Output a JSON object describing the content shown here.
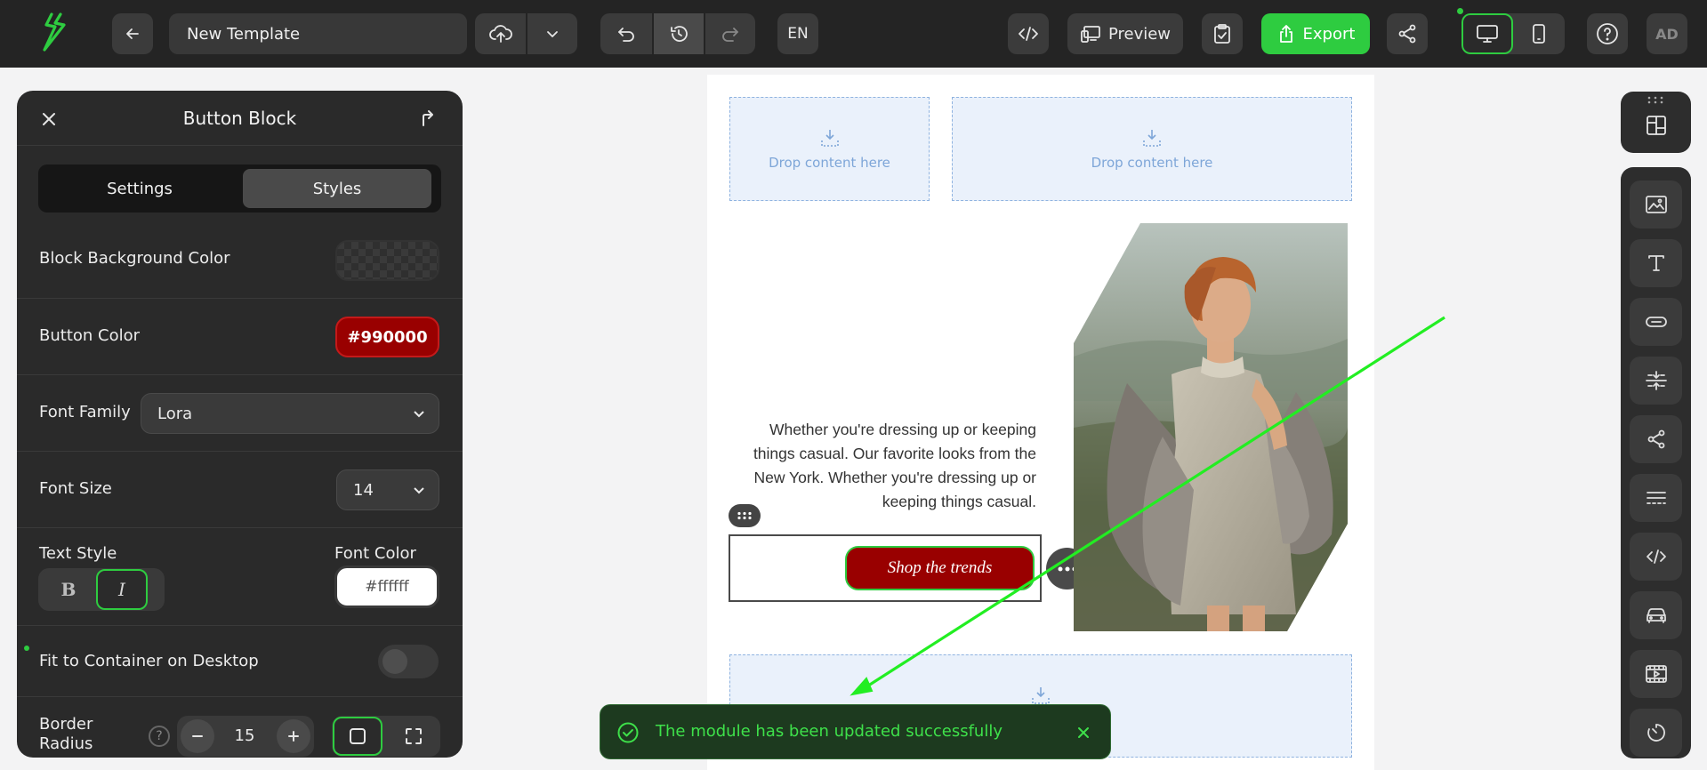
{
  "topbar": {
    "title_value": "New Template",
    "language": "EN",
    "preview_label": "Preview",
    "export_label": "Export",
    "avatar_initials": "AD",
    "accent": "#2ecc40"
  },
  "panel": {
    "title": "Button Block",
    "tabs": [
      {
        "label": "Settings"
      },
      {
        "label": "Styles"
      }
    ],
    "active_tab": "Styles",
    "block_bg_label": "Block Background Color",
    "button_color_label": "Button Color",
    "button_color_value": "#990000",
    "font_family_label": "Font Family",
    "font_family_value": "Lora",
    "font_size_label": "Font Size",
    "font_size_value": "14",
    "text_style_label": "Text Style",
    "bold_label": "B",
    "italic_label": "I",
    "font_color_label": "Font Color",
    "font_color_value": "#ffffff",
    "fit_label": "Fit to Container on Desktop",
    "fit_enabled": false,
    "border_radius_label_1": "Border",
    "border_radius_label_2": "Radius",
    "border_radius_value": "15"
  },
  "canvas": {
    "drop_text": "Drop content here",
    "body_text": "Whether you're dressing up or keeping things casual. Our favorite looks from the New York. Whether you're dressing up or keeping things casual.",
    "button_label": "Shop the trends",
    "button_color": "#990000"
  },
  "toast": {
    "message": "The module has been updated successfully",
    "color": "#3ee04a"
  },
  "right_toolbar": {
    "items": [
      "image-icon",
      "text-icon",
      "button-icon",
      "spacer-icon",
      "social-icon",
      "divider-icon",
      "html-icon",
      "car-icon",
      "video-icon",
      "timer-icon"
    ]
  }
}
